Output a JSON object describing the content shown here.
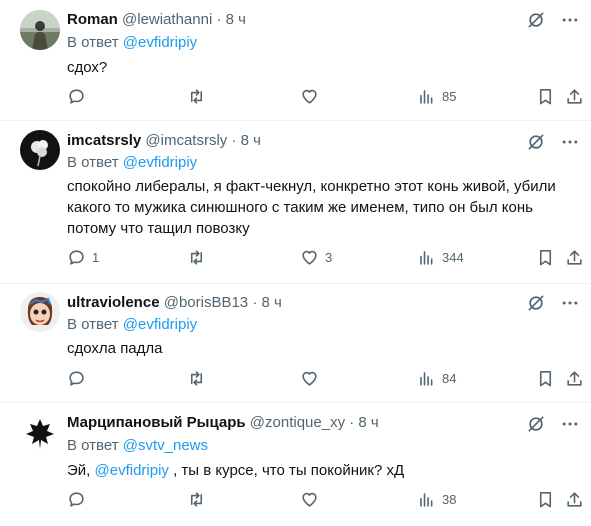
{
  "reply_prefix": "В ответ",
  "tweets": [
    {
      "name": "Roman",
      "handle": "@lewiathanni",
      "dot": "·",
      "time": "8 ч",
      "reply_to": "@evfidripiy",
      "text": "сдох?",
      "replies": "",
      "retweets": "",
      "likes": "",
      "views": "85"
    },
    {
      "name": "imcatsrsly",
      "handle": "@imcatsrsly",
      "dot": "·",
      "time": "8 ч",
      "reply_to": "@evfidripiy",
      "text": "спокойно либералы, я факт-чекнул, конкретно этот конь живой, убили какого то мужика синюшного с таким же именем, типо он был конь потому что тащил повозку",
      "replies": "1",
      "retweets": "",
      "likes": "3",
      "views": "344"
    },
    {
      "name": "ultraviolence",
      "handle": "@borisBB13",
      "dot": "·",
      "time": "8 ч",
      "reply_to": "@evfidripiy",
      "text": "сдохла падла",
      "replies": "",
      "retweets": "",
      "likes": "",
      "views": "84"
    },
    {
      "name": "Марципановый Рыцарь",
      "handle": "@zontique_xy",
      "dot": "·",
      "time": "8 ч",
      "reply_to": "@svtv_news",
      "text_before": "Эй, ",
      "text_mention": "@evfidripiy",
      "text_after": " , ты в курсе, что ты покойник? хД",
      "replies": "",
      "retweets": "",
      "likes": "",
      "views": "38"
    }
  ],
  "colors": {
    "accent": "#1d9bf0",
    "muted": "#536471",
    "text": "#0f1419",
    "divider": "#eff3f4"
  },
  "icons": [
    "grok-icon",
    "more-icon",
    "reply-icon",
    "retweet-icon",
    "like-icon",
    "views-icon",
    "bookmark-icon",
    "share-icon"
  ]
}
